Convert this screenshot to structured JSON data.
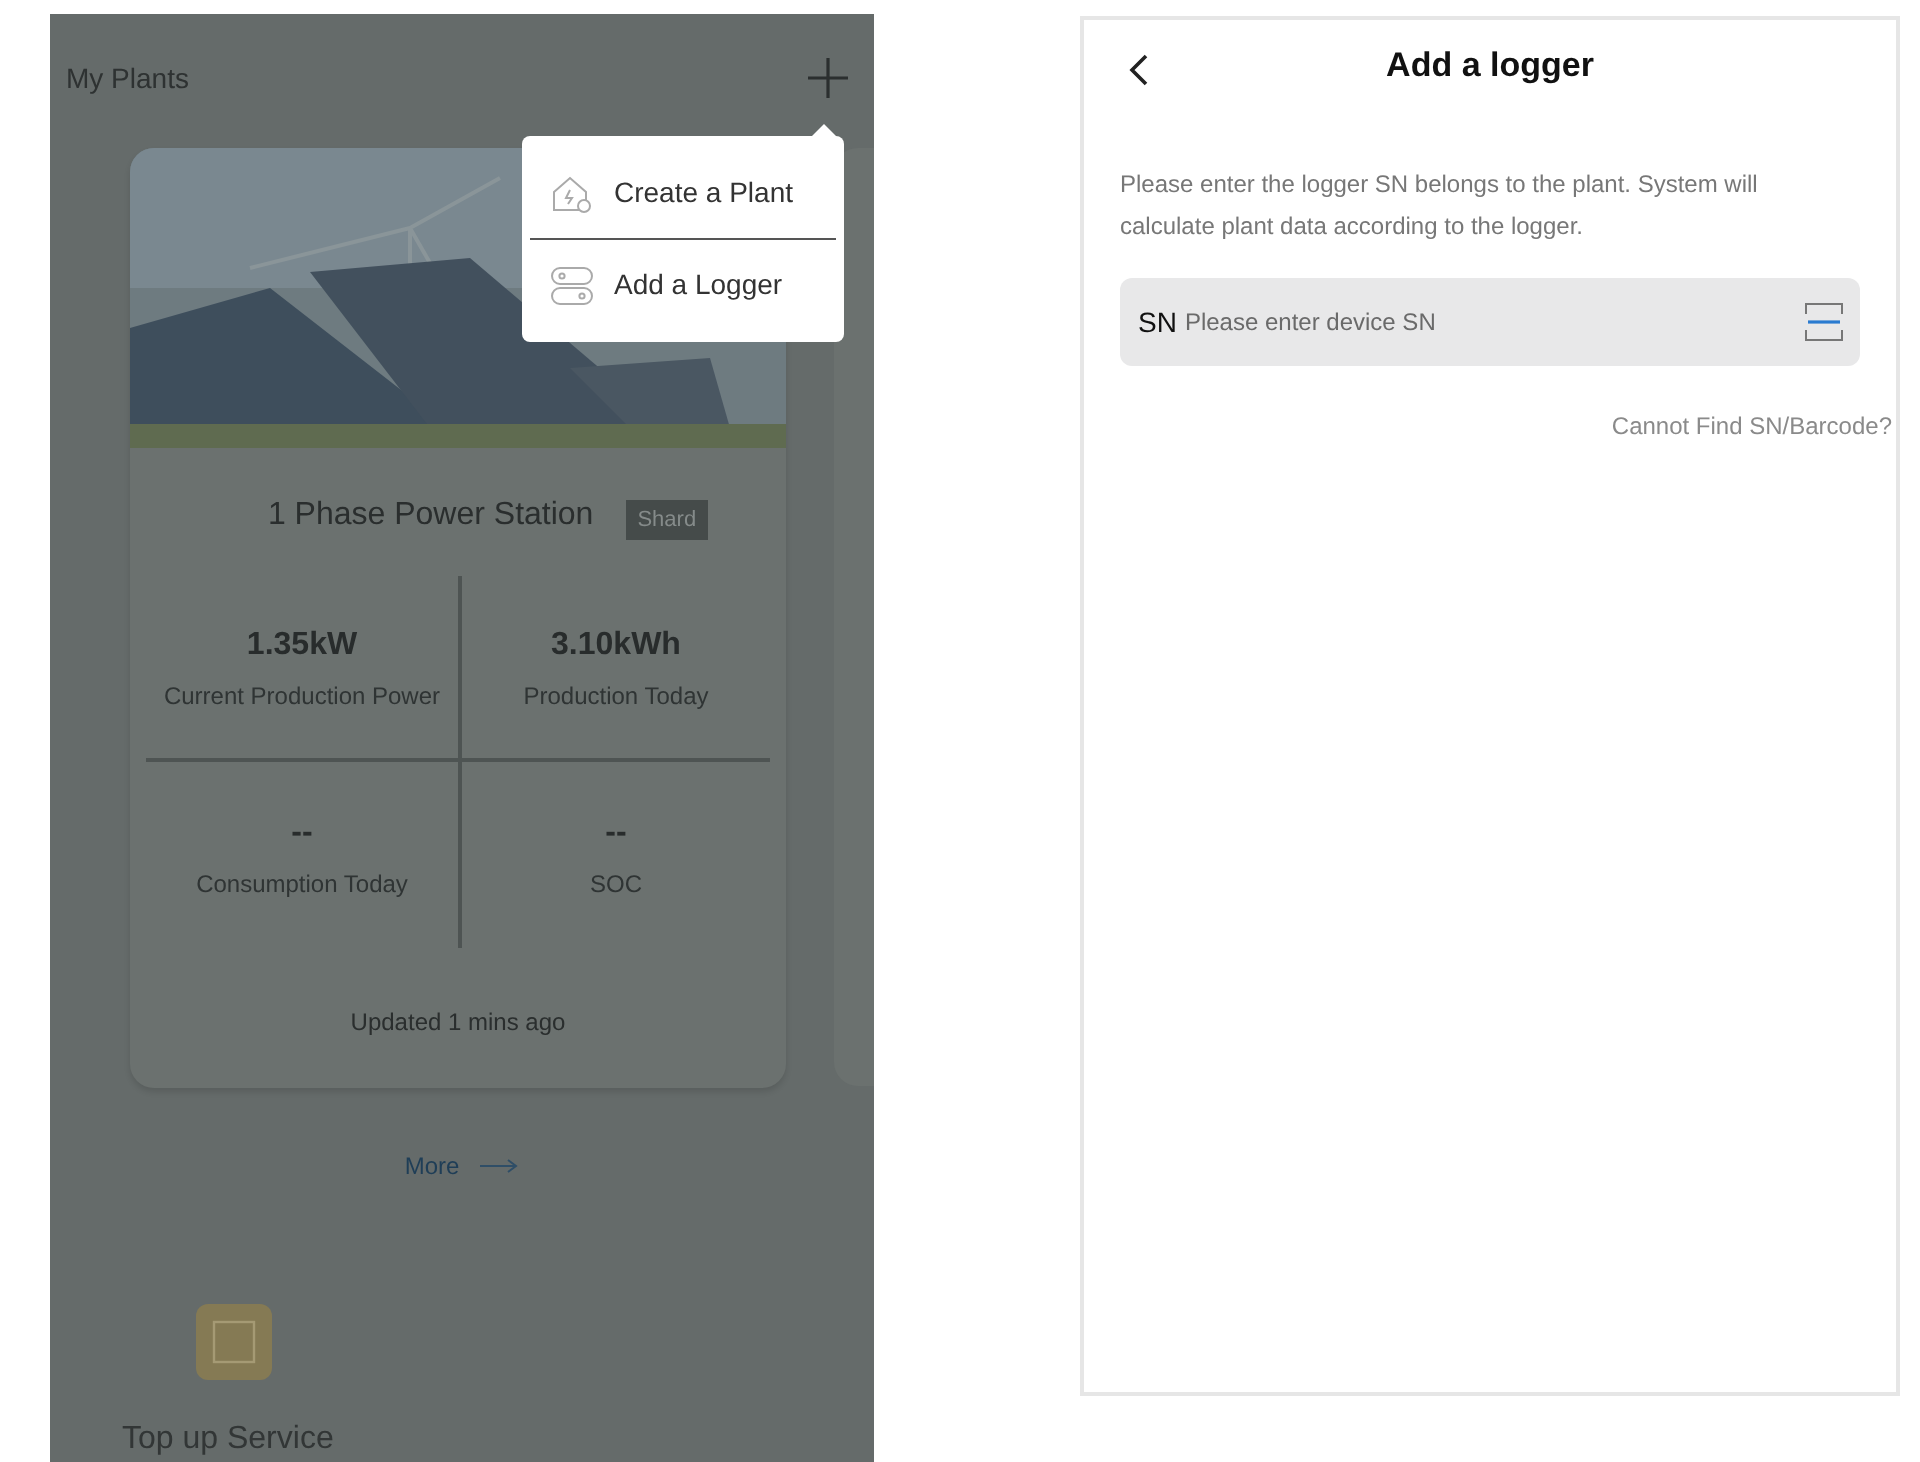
{
  "my_plants": {
    "title": "My Plants",
    "plant_card": {
      "name": "1 Phase Power Station",
      "tag": "Shard",
      "stats": [
        {
          "value": "1.35kW",
          "label": "Current Production Power"
        },
        {
          "value": "3.10kWh",
          "label": "Production Today"
        },
        {
          "value": "--",
          "label": "Consumption Today"
        },
        {
          "value": "--",
          "label": "SOC"
        }
      ],
      "updated": "Updated 1 mins ago"
    },
    "more_link": "More",
    "services": [
      {
        "label": "Top up Service"
      }
    ],
    "popup_menu": [
      {
        "kind": "plant",
        "label": "Create a Plant"
      },
      {
        "kind": "logger",
        "label": "Add a Logger"
      }
    ]
  },
  "add_logger": {
    "title": "Add a logger",
    "description": "Please enter the logger SN belongs to the plant. System will calculate plant data according to the logger.",
    "field": {
      "label": "SN",
      "placeholder": "Please enter device SN"
    },
    "help_link": "Cannot Find SN/Barcode?"
  }
}
